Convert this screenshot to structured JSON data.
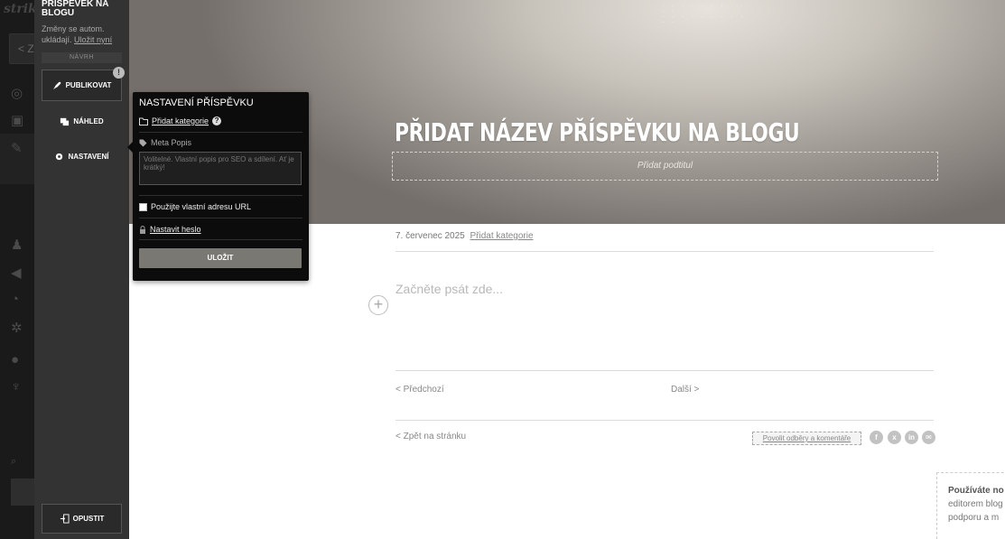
{
  "app_sidebar": {
    "brand": "strik",
    "back_chip": "< Z"
  },
  "editor_panel": {
    "title": "PŘÍSPĚVEK NA BLOGU",
    "autosave_text": "Změny se autom. ukládají.",
    "save_now_link": "Uložit nyní",
    "draft_label": "NÁVRH",
    "publish_label": "PUBLIKOVAT",
    "publish_badge": "!",
    "preview_label": "NÁHLED",
    "settings_label": "NASTAVENÍ",
    "exit_label": "OPUSTIT"
  },
  "hero": {
    "title": "PŘIDAT NÁZEV PŘÍSPĚVKU NA BLOGU",
    "subtitle_placeholder": "Přidat podtitul",
    "gradient_light": "#e7e3dc",
    "gradient_dark": "#756f6c"
  },
  "post": {
    "date": "7. červenec 2025",
    "add_category": "Přidat kategorie",
    "body_placeholder": "Začněte psát zde...",
    "add_block": "+",
    "prev_label": "< Předchozí",
    "next_label": "Další >",
    "back_label": "< Zpět na stránku",
    "subscribe_label": "Povolit odběry a komentáře",
    "share_icons": [
      "facebook-icon",
      "x-twitter-icon",
      "linkedin-icon",
      "email-icon"
    ]
  },
  "settings_popup": {
    "title": "NASTAVENÍ PŘÍSPĚVKU",
    "add_category": "Přidat kategorie",
    "help": "?",
    "meta_label": "Meta Popis",
    "meta_placeholder": "Volitelné. Vlastní popis pro SEO a sdílení. Ať je krátký!",
    "custom_url_label": "Použijte vlastní adresu URL",
    "set_password": "Nastavit heslo",
    "save_label": "ULOŽIT"
  },
  "help_notice": {
    "line1": "Používáte no",
    "line2": "editorem blog",
    "line3": "podporu a m"
  },
  "colors": {
    "panel_bg": "#333333",
    "popup_bg": "#0c0c0c",
    "save_button": "#7a7872"
  }
}
